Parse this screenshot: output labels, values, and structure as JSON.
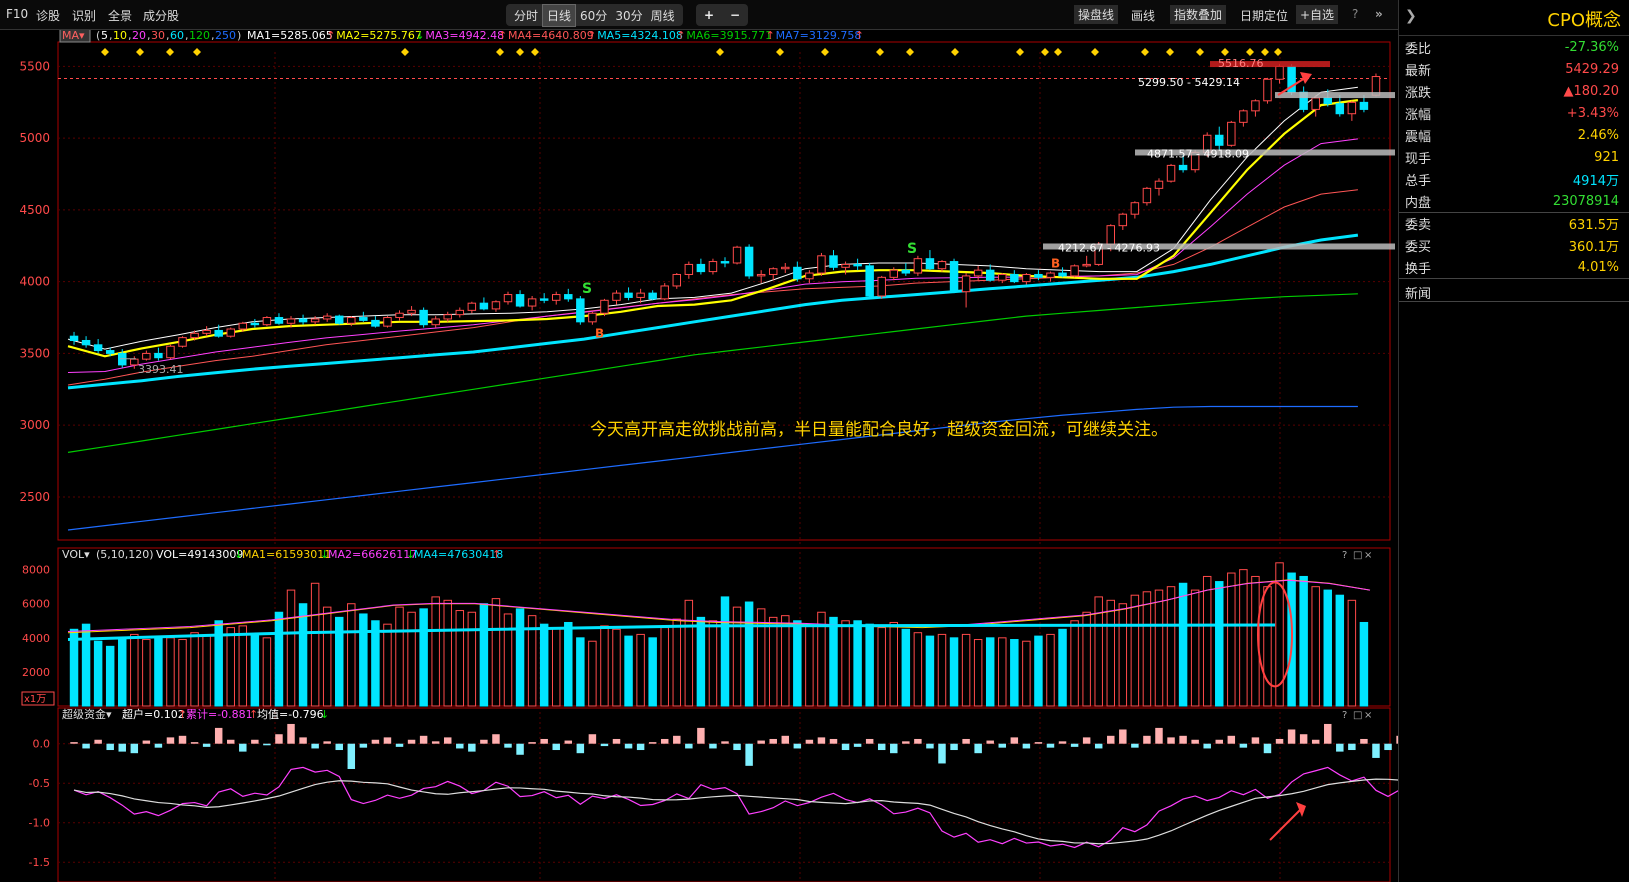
{
  "toolbar": {
    "items": [
      "F10",
      "诊股",
      "识别",
      "全景",
      "成分股"
    ],
    "tabs": [
      "分时",
      "日线",
      "60分",
      "30分",
      "周线"
    ],
    "active_tab": "日线",
    "zoom_in": "+",
    "zoom_out": "−",
    "right_items": [
      "操盘线",
      "画线",
      "指数叠加",
      "日期定位",
      "+自选"
    ],
    "help": "?"
  },
  "colors": {
    "up": "#ff4a4a",
    "down": "#00e5ff",
    "ma1": "#ffffff",
    "ma2": "#ffff00",
    "ma3": "#ff40ff",
    "ma4": "#ff5555",
    "ma5": "#00e5ff",
    "ma6": "#00cc00",
    "ma7": "#1e6cff",
    "bg": "#000000",
    "grid": "#8b0000"
  },
  "price_panel": {
    "ma_tag": "MA",
    "ma_params": {
      "prefix": "(",
      "parts": [
        "5",
        "10",
        "20",
        "30",
        "60",
        "120",
        "250"
      ],
      "suffix": ")"
    },
    "ma_values": [
      {
        "label": "MA1=5285.065",
        "arrow": "↑"
      },
      {
        "label": "MA2=5275.767",
        "arrow": "↓"
      },
      {
        "label": "MA3=4942.48",
        "arrow": "↑"
      },
      {
        "label": "MA4=4640.809",
        "arrow": "↑"
      },
      {
        "label": "MA5=4324.108",
        "arrow": "↑"
      },
      {
        "label": "MA6=3915.771",
        "arrow": "↑"
      },
      {
        "label": "MA7=3129.758",
        "arrow": "↑"
      }
    ],
    "y_ticks": [
      "5500",
      "5000",
      "4500",
      "4000",
      "3500",
      "3000",
      "2500"
    ],
    "annotations": [
      "5516.76",
      "5299.50 - 5429.14",
      "4871.57 - 4918.09",
      "4212.67 - 4276.93",
      "3393.41"
    ],
    "signals": [
      "S",
      "S",
      "B",
      "B"
    ],
    "comment": "今天高开高走欲挑战前高，半日量能配合良好，超级资金回流，可继续关注。"
  },
  "vol_panel": {
    "title": "VOL",
    "params": "(5,10,120)",
    "values": [
      {
        "label": "VOL=49143009",
        "arrow": "↓"
      },
      {
        "label": "MA1=61593011",
        "arrow": "↓"
      },
      {
        "label": "MA2=66626117",
        "arrow": "↓"
      },
      {
        "label": "MA4=47630418",
        "arrow": "↑"
      }
    ],
    "y_ticks": [
      "8000",
      "6000",
      "4000",
      "2000"
    ],
    "unit": "x1万"
  },
  "fund_panel": {
    "title": "超级资金",
    "values": [
      {
        "label": "超户=0.102",
        "arrow": "↑"
      },
      {
        "label": "累计=-0.881",
        "arrow": "↑"
      },
      {
        "label": "均值=-0.796",
        "arrow": "↓"
      }
    ],
    "y_ticks": [
      "0.0",
      "-0.5",
      "-1.0",
      "-1.5"
    ]
  },
  "panel_controls": [
    "?",
    "□",
    "×"
  ],
  "right_panel": {
    "title": "CPO概念",
    "rows": [
      {
        "k": "委比",
        "v": "-27.36%",
        "c": "#33dd33"
      },
      {
        "k": "最新",
        "v": "5429.29",
        "c": "#ff4a4a"
      },
      {
        "k": "涨跌",
        "v": "▲180.20",
        "c": "#ff4a4a"
      },
      {
        "k": "涨幅",
        "v": "+3.43%",
        "c": "#ff4a4a"
      },
      {
        "k": "震幅",
        "v": "2.46%",
        "c": "#ffd200"
      },
      {
        "k": "现手",
        "v": "921",
        "c": "#ffd200"
      },
      {
        "k": "总手",
        "v": "4914万",
        "c": "#00e5ff"
      },
      {
        "k": "内盘",
        "v": "23078914",
        "c": "#33dd33"
      },
      {
        "k": "委卖",
        "v": "631.5万",
        "c": "#ffd200"
      },
      {
        "k": "委买",
        "v": "360.1万",
        "c": "#ffd200"
      },
      {
        "k": "换手",
        "v": "4.01%",
        "c": "#ffd200"
      }
    ],
    "news": "新闻"
  },
  "chart_data": {
    "type": "candlestick",
    "title": "CPO概念",
    "ylim": [
      2200,
      5600
    ],
    "ohlc": [
      [
        3620,
        3650,
        3560,
        3590
      ],
      [
        3590,
        3620,
        3540,
        3560
      ],
      [
        3560,
        3600,
        3500,
        3520
      ],
      [
        3520,
        3540,
        3480,
        3500
      ],
      [
        3500,
        3530,
        3400,
        3420
      ],
      [
        3420,
        3480,
        3393,
        3460
      ],
      [
        3460,
        3520,
        3450,
        3500
      ],
      [
        3500,
        3540,
        3450,
        3470
      ],
      [
        3470,
        3560,
        3460,
        3550
      ],
      [
        3550,
        3620,
        3540,
        3610
      ],
      [
        3610,
        3660,
        3590,
        3640
      ],
      [
        3640,
        3690,
        3620,
        3660
      ],
      [
        3660,
        3700,
        3610,
        3620
      ],
      [
        3620,
        3680,
        3610,
        3670
      ],
      [
        3670,
        3720,
        3650,
        3710
      ],
      [
        3710,
        3740,
        3680,
        3700
      ],
      [
        3700,
        3760,
        3690,
        3750
      ],
      [
        3750,
        3780,
        3700,
        3710
      ],
      [
        3710,
        3760,
        3680,
        3740
      ],
      [
        3740,
        3770,
        3700,
        3720
      ],
      [
        3720,
        3760,
        3700,
        3740
      ],
      [
        3740,
        3780,
        3720,
        3760
      ],
      [
        3760,
        3770,
        3700,
        3710
      ],
      [
        3710,
        3760,
        3690,
        3750
      ],
      [
        3750,
        3790,
        3720,
        3730
      ],
      [
        3730,
        3760,
        3680,
        3690
      ],
      [
        3690,
        3760,
        3680,
        3750
      ],
      [
        3750,
        3800,
        3730,
        3780
      ],
      [
        3780,
        3830,
        3760,
        3800
      ],
      [
        3800,
        3820,
        3680,
        3700
      ],
      [
        3700,
        3760,
        3680,
        3740
      ],
      [
        3740,
        3790,
        3720,
        3770
      ],
      [
        3770,
        3820,
        3750,
        3800
      ],
      [
        3800,
        3860,
        3780,
        3850
      ],
      [
        3850,
        3890,
        3800,
        3810
      ],
      [
        3810,
        3870,
        3790,
        3860
      ],
      [
        3860,
        3930,
        3840,
        3910
      ],
      [
        3910,
        3940,
        3820,
        3830
      ],
      [
        3830,
        3900,
        3800,
        3880
      ],
      [
        3880,
        3920,
        3850,
        3870
      ],
      [
        3870,
        3930,
        3840,
        3910
      ],
      [
        3910,
        3950,
        3860,
        3880
      ],
      [
        3880,
        3900,
        3700,
        3720
      ],
      [
        3720,
        3790,
        3700,
        3780
      ],
      [
        3780,
        3880,
        3760,
        3870
      ],
      [
        3870,
        3940,
        3840,
        3920
      ],
      [
        3920,
        3960,
        3870,
        3890
      ],
      [
        3890,
        3950,
        3850,
        3920
      ],
      [
        3920,
        3940,
        3870,
        3880
      ],
      [
        3880,
        3990,
        3870,
        3970
      ],
      [
        3970,
        4060,
        3950,
        4050
      ],
      [
        4050,
        4140,
        4020,
        4120
      ],
      [
        4120,
        4160,
        4050,
        4070
      ],
      [
        4070,
        4160,
        4050,
        4140
      ],
      [
        4140,
        4170,
        4100,
        4130
      ],
      [
        4130,
        4250,
        4120,
        4240
      ],
      [
        4240,
        4260,
        4020,
        4040
      ],
      [
        4040,
        4080,
        3990,
        4050
      ],
      [
        4050,
        4100,
        4010,
        4090
      ],
      [
        4090,
        4130,
        4060,
        4100
      ],
      [
        4100,
        4140,
        4000,
        4020
      ],
      [
        4020,
        4080,
        3990,
        4060
      ],
      [
        4060,
        4200,
        4040,
        4180
      ],
      [
        4180,
        4220,
        4080,
        4100
      ],
      [
        4100,
        4140,
        4050,
        4120
      ],
      [
        4120,
        4160,
        4080,
        4110
      ],
      [
        4110,
        4130,
        3890,
        3900
      ],
      [
        3900,
        4040,
        3880,
        4030
      ],
      [
        4030,
        4100,
        4010,
        4080
      ],
      [
        4080,
        4130,
        4040,
        4060
      ],
      [
        4060,
        4180,
        4040,
        4160
      ],
      [
        4160,
        4220,
        4080,
        4090
      ],
      [
        4090,
        4150,
        4070,
        4140
      ],
      [
        4140,
        4160,
        3920,
        3930
      ],
      [
        3930,
        4060,
        3820,
        4040
      ],
      [
        4040,
        4110,
        4010,
        4080
      ],
      [
        4080,
        4120,
        4000,
        4010
      ],
      [
        4010,
        4060,
        3990,
        4050
      ],
      [
        4050,
        4080,
        3990,
        4000
      ],
      [
        4000,
        4060,
        3980,
        4050
      ],
      [
        4050,
        4080,
        4010,
        4030
      ],
      [
        4030,
        4070,
        4000,
        4060
      ],
      [
        4060,
        4100,
        4030,
        4040
      ],
      [
        4040,
        4120,
        4030,
        4110
      ],
      [
        4110,
        4180,
        4100,
        4120
      ],
      [
        4120,
        4276,
        4110,
        4260
      ],
      [
        4260,
        4400,
        4212,
        4390
      ],
      [
        4390,
        4480,
        4360,
        4470
      ],
      [
        4470,
        4560,
        4440,
        4550
      ],
      [
        4550,
        4660,
        4530,
        4650
      ],
      [
        4650,
        4720,
        4600,
        4700
      ],
      [
        4700,
        4820,
        4690,
        4810
      ],
      [
        4810,
        4880,
        4760,
        4780
      ],
      [
        4780,
        4918,
        4760,
        4900
      ],
      [
        4900,
        5040,
        4871,
        5020
      ],
      [
        5020,
        5080,
        4920,
        4950
      ],
      [
        4950,
        5120,
        4940,
        5110
      ],
      [
        5110,
        5200,
        5080,
        5190
      ],
      [
        5190,
        5270,
        5150,
        5260
      ],
      [
        5260,
        5420,
        5240,
        5410
      ],
      [
        5410,
        5516,
        5380,
        5500
      ],
      [
        5500,
        5516,
        5300,
        5320
      ],
      [
        5320,
        5360,
        5180,
        5200
      ],
      [
        5200,
        5300,
        5150,
        5280
      ],
      [
        5280,
        5340,
        5220,
        5240
      ],
      [
        5240,
        5300,
        5150,
        5170
      ],
      [
        5170,
        5260,
        5120,
        5249
      ],
      [
        5249,
        5300,
        5180,
        5200
      ],
      [
        5299,
        5450,
        5290,
        5429
      ]
    ],
    "ma5": [
      3570,
      3500,
      3555,
      3600,
      3650,
      3690,
      3710,
      3720,
      3730,
      3740,
      3740,
      3745,
      3750,
      3760,
      3780,
      3810,
      3850,
      3860,
      3890,
      3970,
      4060,
      4090,
      4100,
      4100,
      4090,
      4080,
      4060,
      4050,
      4040,
      4040,
      4200,
      4500,
      4800,
      5050,
      5250,
      5285
    ],
    "ma30": [
      3280,
      3320,
      3370,
      3410,
      3450,
      3480,
      3520,
      3560,
      3590,
      3620,
      3650,
      3680,
      3720,
      3760,
      3790,
      3820,
      3850,
      3880,
      3910,
      3930,
      3950,
      3960,
      3970,
      3990,
      4000,
      4010,
      4020,
      4030,
      4040,
      4060,
      4120,
      4240,
      4380,
      4520,
      4610,
      4640
    ],
    "ma60": [
      3260,
      3285,
      3310,
      3340,
      3365,
      3390,
      3410,
      3430,
      3450,
      3470,
      3490,
      3510,
      3540,
      3570,
      3600,
      3640,
      3680,
      3720,
      3760,
      3800,
      3840,
      3870,
      3890,
      3910,
      3930,
      3950,
      3970,
      3990,
      4010,
      4030,
      4070,
      4120,
      4180,
      4240,
      4290,
      4324
    ],
    "ma120": [
      2810,
      2850,
      2890,
      2930,
      2970,
      3010,
      3050,
      3090,
      3130,
      3170,
      3210,
      3250,
      3290,
      3330,
      3370,
      3410,
      3450,
      3490,
      3520,
      3550,
      3580,
      3610,
      3640,
      3670,
      3700,
      3730,
      3760,
      3780,
      3800,
      3820,
      3840,
      3860,
      3880,
      3895,
      3905,
      3915
    ],
    "ma250": [
      2270,
      2300,
      2330,
      2360,
      2390,
      2420,
      2450,
      2480,
      2510,
      2540,
      2570,
      2600,
      2630,
      2660,
      2690,
      2720,
      2750,
      2780,
      2810,
      2840,
      2870,
      2900,
      2930,
      2960,
      2990,
      3020,
      3045,
      3070,
      3090,
      3110,
      3125,
      3130,
      3130,
      3130,
      3130,
      3130
    ],
    "volume": [
      4500,
      4800,
      3800,
      3500,
      4000,
      4200,
      3900,
      4100,
      4000,
      3900,
      4300,
      4100,
      5000,
      4600,
      4700,
      4200,
      4000,
      5500,
      6800,
      6000,
      7200,
      5800,
      5200,
      6000,
      5400,
      5000,
      4800,
      5800,
      5500,
      5700,
      6400,
      6200,
      5600,
      5500,
      6000,
      6300,
      5400,
      5700,
      5300,
      4800,
      4600,
      4900,
      4000,
      3800,
      4700,
      4500,
      4100,
      4200,
      4000,
      4600,
      5100,
      6200,
      5200,
      5000,
      6400,
      5800,
      6100,
      5700,
      5200,
      5300,
      5000,
      4700,
      5500,
      5200,
      5000,
      5000,
      4800,
      4600,
      4900,
      4500,
      4300,
      4100,
      4200,
      4000,
      4200,
      3900,
      4000,
      4000,
      3900,
      3800,
      4100,
      4200,
      4500,
      5000,
      5500,
      6400,
      6200,
      6000,
      6500,
      6700,
      6800,
      7000,
      7200,
      6800,
      7600,
      7300,
      7800,
      8000,
      7600,
      7000,
      8400,
      7800,
      7600,
      7000,
      6800,
      6500,
      6200,
      4900
    ],
    "volume_ma5": [
      4300,
      4400,
      4500,
      4600,
      4800,
      5000,
      5300,
      5600,
      5900,
      6000,
      6000,
      5800,
      5600,
      5400,
      5200,
      5000,
      4900,
      4850,
      4800,
      4700,
      4650,
      4600,
      4700,
      4900,
      5100,
      5300,
      5700,
      6200,
      6800,
      7200,
      7400,
      7200,
      6800
    ],
    "fund": [
      0.02,
      -0.06,
      0.05,
      -0.08,
      -0.1,
      -0.12,
      0.04,
      -0.05,
      0.08,
      0.1,
      0.02,
      -0.04,
      0.2,
      0.05,
      -0.1,
      0.05,
      -0.02,
      0.12,
      0.25,
      0.08,
      -0.06,
      0.03,
      -0.08,
      -0.32,
      -0.05,
      0.05,
      0.08,
      -0.04,
      0.05,
      0.1,
      0.03,
      0.08,
      -0.06,
      -0.1,
      0.05,
      0.12,
      -0.05,
      -0.14,
      0.02,
      0.06,
      -0.08,
      0.04,
      -0.12,
      0.12,
      -0.03,
      0.06,
      -0.06,
      -0.08,
      0.02,
      0.06,
      0.1,
      -0.06,
      0.2,
      -0.06,
      0.03,
      -0.08,
      -0.28,
      0.04,
      0.06,
      0.1,
      -0.06,
      0.05,
      0.08,
      0.06,
      -0.08,
      -0.04,
      0.06,
      -0.08,
      -0.12,
      0.03,
      0.06,
      -0.06,
      -0.25,
      -0.08,
      0.06,
      -0.12,
      0.04,
      -0.05,
      0.08,
      -0.06,
      0.02,
      -0.05,
      0.03,
      -0.04,
      0.08,
      -0.06,
      0.1,
      0.18,
      -0.05,
      0.1,
      0.2,
      0.08,
      0.1,
      0.05,
      -0.06,
      0.05,
      0.1,
      -0.05,
      0.08,
      -0.12,
      0.06,
      0.18,
      0.12,
      0.05,
      0.25,
      -0.1,
      -0.08,
      0.06,
      -0.18,
      -0.08,
      0.1
    ]
  }
}
